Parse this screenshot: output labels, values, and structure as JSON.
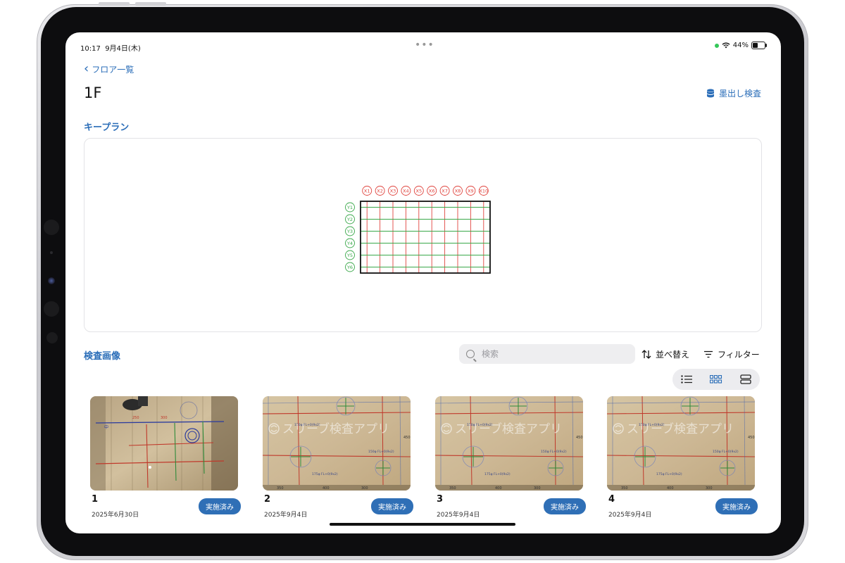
{
  "status_bar": {
    "time": "10:17",
    "date": "9月4日(木)",
    "battery": "44%",
    "battery_level": 0.44
  },
  "nav": {
    "back_label": "フロア一覧",
    "title": "1F",
    "inspect_button": "墨出し検査"
  },
  "keyplan": {
    "section_title": "キープラン",
    "x_labels": [
      "X1",
      "X2",
      "X3",
      "X4",
      "X5",
      "X6",
      "X7",
      "X8",
      "X9",
      "X10"
    ],
    "y_labels": [
      "Y1",
      "Y2",
      "Y3",
      "Y4",
      "Y5",
      "Y6"
    ]
  },
  "images": {
    "section_title": "検査画像",
    "search_placeholder": "検索",
    "sort_label": "並べ替え",
    "filter_label": "フィルター",
    "view_modes": [
      "list-icon",
      "grid-icon",
      "rows-icon"
    ],
    "active_view": "grid-icon",
    "watermark": "スリーブ検査アプリ",
    "cards": [
      {
        "num": "1",
        "date": "2025年6月30日",
        "status": "実施済み"
      },
      {
        "num": "2",
        "date": "2025年9月4日",
        "status": "実施済み"
      },
      {
        "num": "3",
        "date": "2025年9月4日",
        "status": "実施済み"
      },
      {
        "num": "4",
        "date": "2025年9月4日",
        "status": "実施済み"
      }
    ]
  },
  "colors": {
    "accent": "#2a6db8",
    "badge": "#2f6fb6",
    "grid_x": "#e0443e",
    "grid_y": "#3aa84a"
  }
}
